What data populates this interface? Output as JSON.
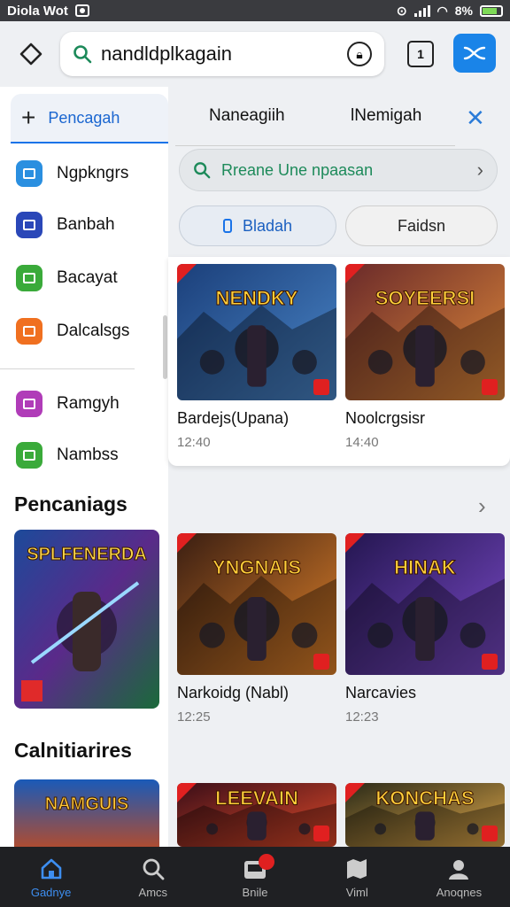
{
  "status_bar": {
    "app_name": "Diola Wot",
    "battery": "8%",
    "battery_level": 0.8
  },
  "toolbar": {
    "url": "nandldplkagain"
  },
  "sidebar": {
    "active_tab": "Pencagah",
    "items": [
      {
        "label": "Ngpkngrs",
        "color": "#2a8fe0"
      },
      {
        "label": "Banbah",
        "color": "#2a47b8"
      },
      {
        "label": "Bacayat",
        "color": "#3aaa3a"
      },
      {
        "label": "Dalcalsgs",
        "color": "#f07020"
      },
      {
        "label": "Ramgyh",
        "color": "#b03cb8"
      },
      {
        "label": "Nambss",
        "color": "#3aaa3a"
      }
    ],
    "section1_title": "Pencaniags",
    "section1_thumb_text": "SPLFENERDA",
    "section2_title": "Calnitiarires",
    "section2_thumb_text": "NAMGUIS"
  },
  "main": {
    "tabs": [
      "Naneagiih",
      "lNemigah"
    ],
    "search_placeholder": "Rreane Une npaasan",
    "filters": {
      "active": "Bladah",
      "inactive": "Faidsn"
    },
    "cards": [
      {
        "title": "Bardejs(Upana)",
        "time": "12:40",
        "thumb_text": "NENDKY",
        "palette": [
          "#1b3f7a",
          "#4a86c8"
        ]
      },
      {
        "title": "Noolcrgsisr",
        "time": "14:40",
        "thumb_text": "SOYEERSI",
        "palette": [
          "#6a2a2a",
          "#e08a3a"
        ]
      },
      {
        "title": "Narkoidg (Nabl)",
        "time": "12:25",
        "thumb_text": "YNGNAIS",
        "palette": [
          "#3a1e12",
          "#e0822a"
        ]
      },
      {
        "title": "Narcavies",
        "time": "12:23",
        "thumb_text": "HINAK",
        "palette": [
          "#241650",
          "#7a4ac8"
        ]
      },
      {
        "title": "",
        "time": "",
        "thumb_text": "LEEVAIN",
        "palette": [
          "#3a0e18",
          "#e04a2a"
        ]
      },
      {
        "title": "",
        "time": "",
        "thumb_text": "KONCHAS",
        "palette": [
          "#2a2a18",
          "#e0a84a"
        ]
      }
    ]
  },
  "bottom_nav": [
    {
      "label": "Gadnye",
      "icon": "home-icon"
    },
    {
      "label": "Amcs",
      "icon": "search-icon"
    },
    {
      "label": "Bnile",
      "icon": "inbox-icon"
    },
    {
      "label": "Viml",
      "icon": "map-icon"
    },
    {
      "label": "Anoqnes",
      "icon": "profile-icon"
    }
  ]
}
